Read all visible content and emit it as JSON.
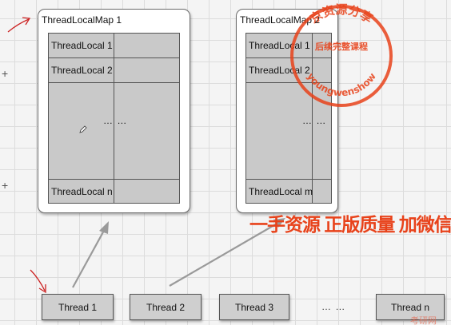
{
  "map1": {
    "title": "ThreadLocalMap 1",
    "rows": [
      "ThreadLocal 1",
      "ThreadLocal 2",
      "ThreadLocal n"
    ],
    "ellipsis": "… …"
  },
  "map2": {
    "title": "ThreadLocalMap 2",
    "rows": [
      "ThreadLocal 1",
      "ThreadLocal 2",
      "ThreadLocal m"
    ],
    "ellipsis": "… …"
  },
  "threads": [
    "Thread 1",
    "Thread 2",
    "Thread 3",
    "Thread n"
  ],
  "threads_ellipsis": "… …",
  "watermark": {
    "banner": "一手资源 正版质量 加微信yc",
    "stamp_top": "京资源分享",
    "stamp_middle": "后续完整课程",
    "stamp_bottom": "youngwenshow",
    "footer_logo": "考研网"
  },
  "colors": {
    "accent": "#e8421a",
    "cell_fill": "#c9c9c9",
    "arrow": "#9a9a9a"
  }
}
